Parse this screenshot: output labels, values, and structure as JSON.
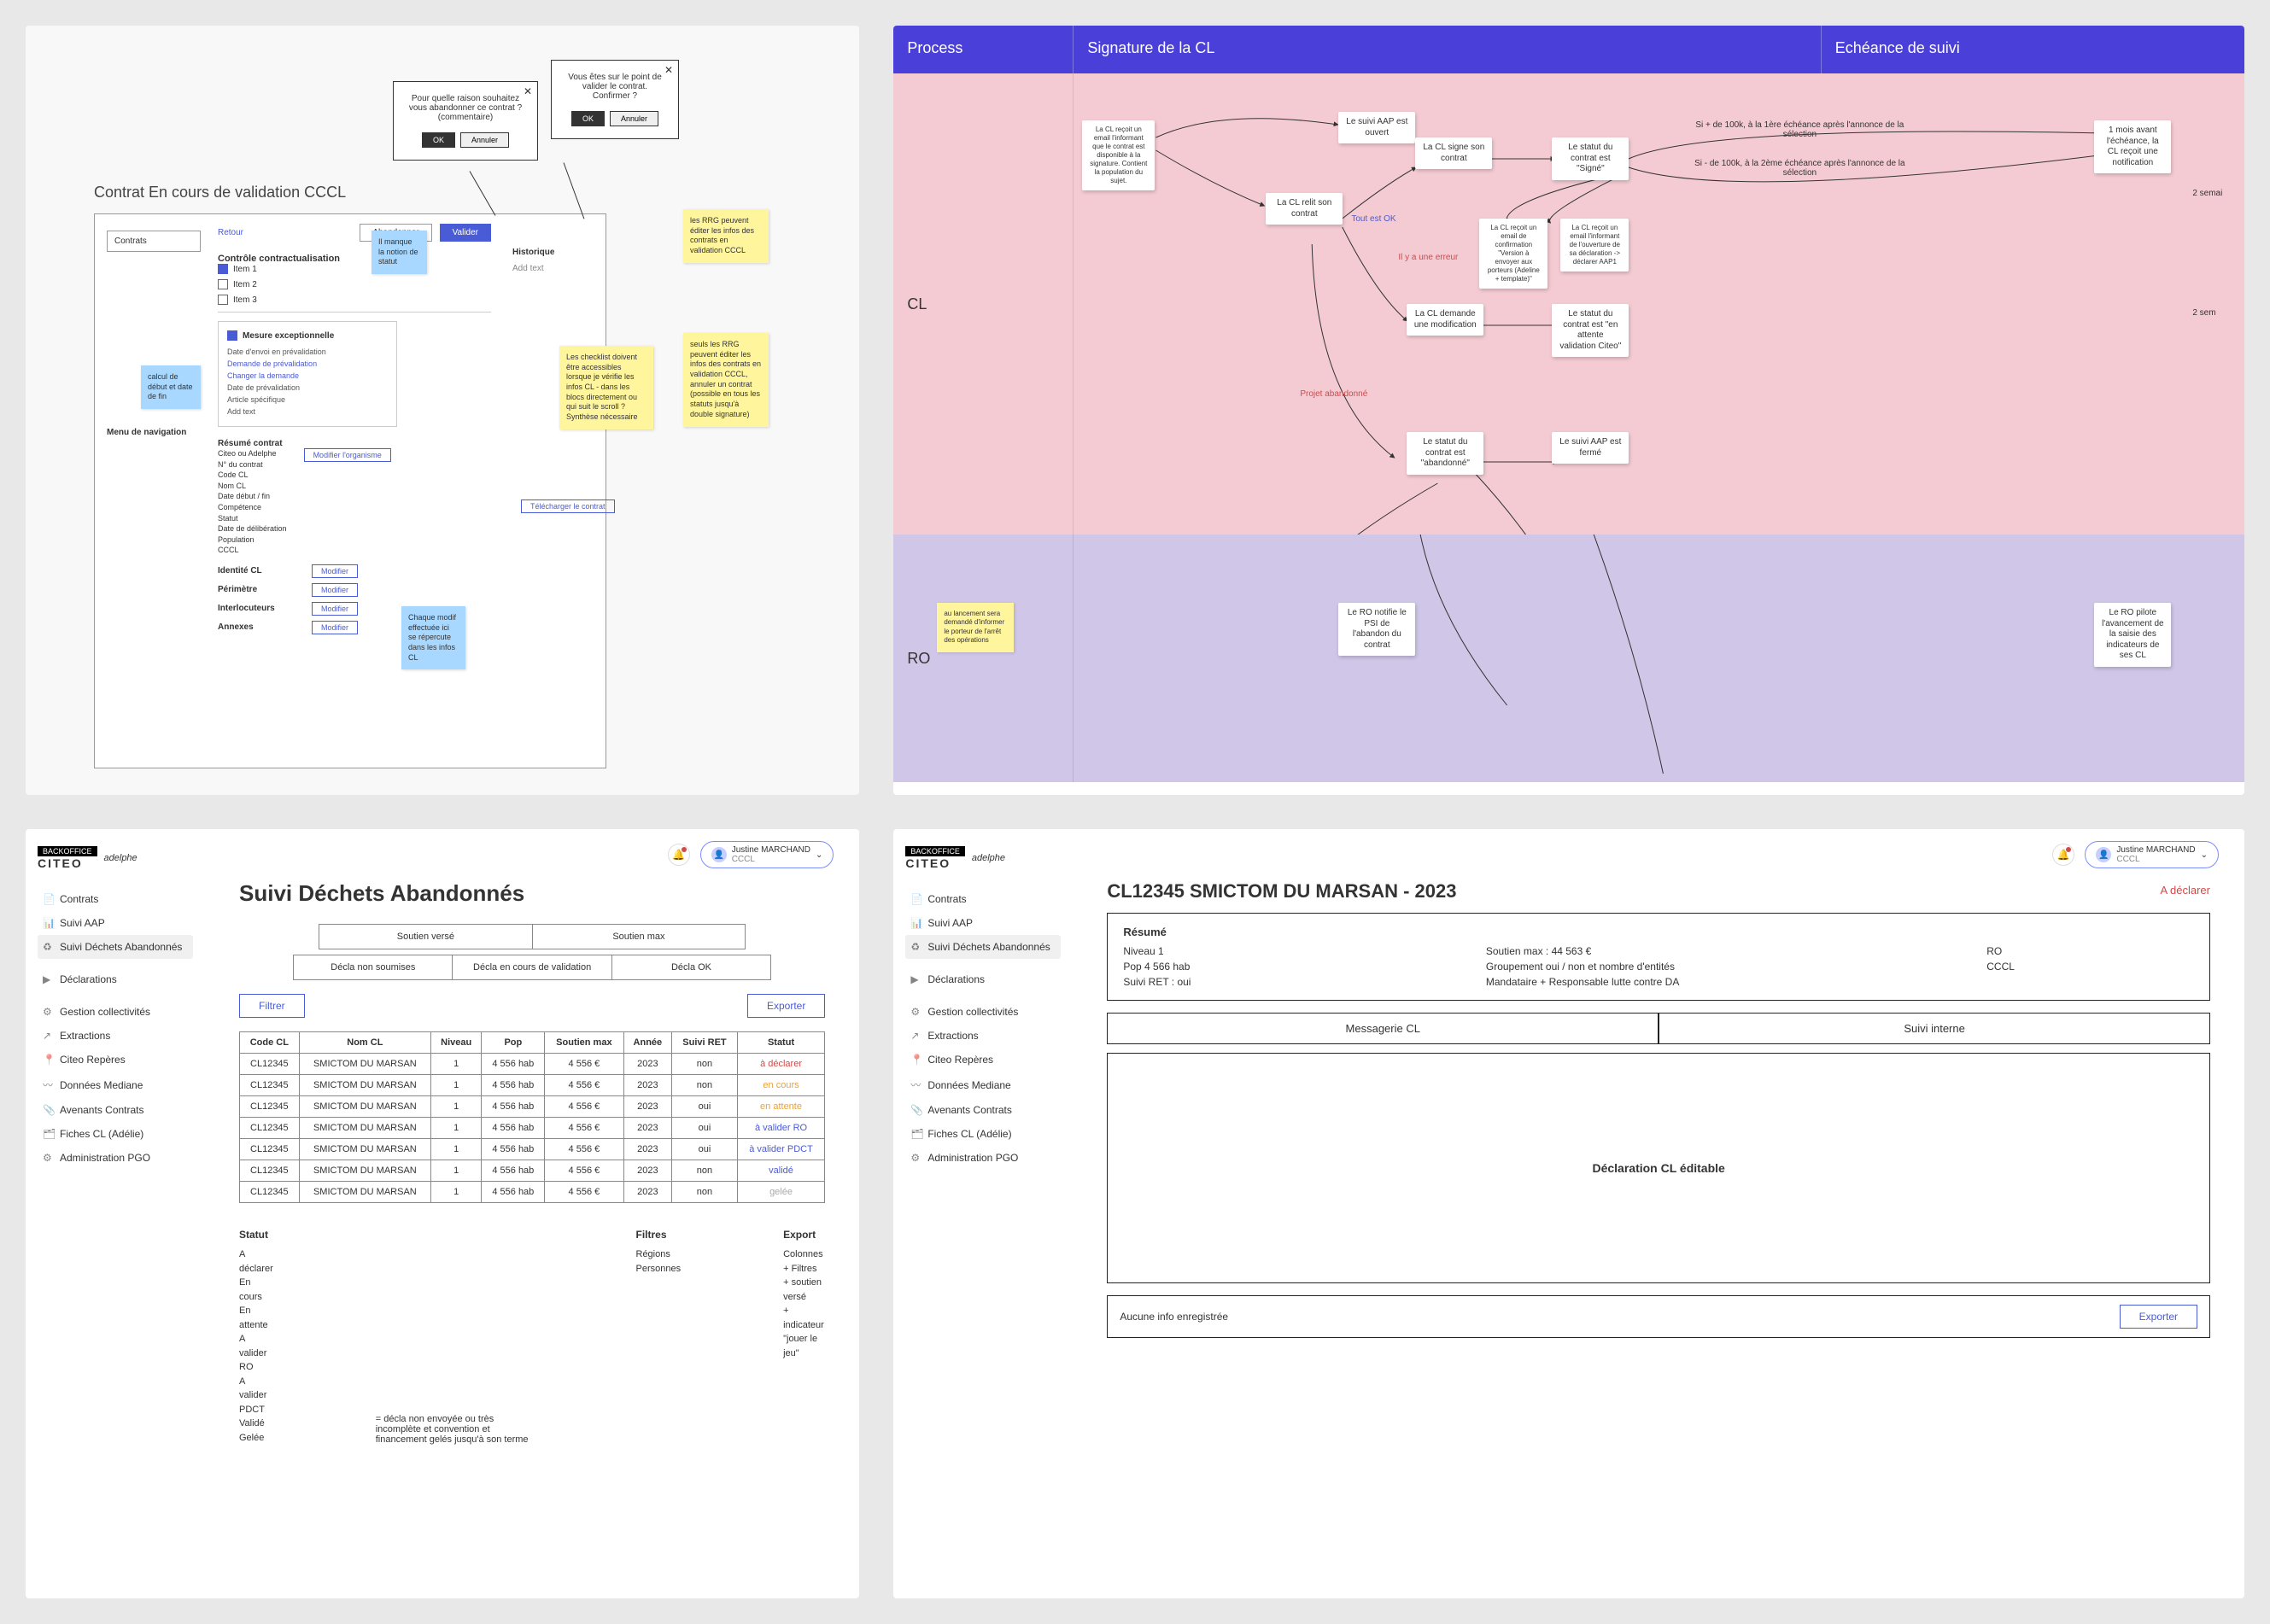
{
  "top_left": {
    "title": "Contrat En cours de validation CCCL",
    "sidebar": {
      "contrats": "Contrats",
      "nav": "Menu de navigation"
    },
    "dialog1": {
      "text": "Pour quelle raison souhaitez vous abandonner ce contrat ? (commentaire)",
      "ok": "OK",
      "cancel": "Annuler"
    },
    "dialog2": {
      "text": "Vous êtes sur le point de valider le contrat. Confirmer ?",
      "ok": "OK",
      "cancel": "Annuler"
    },
    "header": {
      "retour": "Retour",
      "abandon": "Abandonner",
      "valider": "Valider"
    },
    "control_title": "Contrôle contractualisation",
    "items": [
      "Item 1",
      "Item 2",
      "Item 3"
    ],
    "mesure": "Mesure exceptionnelle",
    "mesure_fields": [
      "Date d'envoi en prévalidation",
      "Demande de prévalidation",
      "Changer la demande",
      "Date de prévalidation",
      "Article spécifique",
      "Add text"
    ],
    "hist_title": "Historique",
    "hist_text": "Add text",
    "resume_title": "Résumé contrat",
    "resume_fields": [
      "Citeo ou Adelphe",
      "N° du contrat",
      "Code CL",
      "Nom CL",
      "Date début / fin",
      "Compétence",
      "Statut",
      "Date de délibération",
      "Population",
      "CCCL"
    ],
    "modif_org": "Modifier l'organisme",
    "sections": {
      "identite": "Identité CL",
      "perimetre": "Périmètre",
      "interlocuteurs": "Interlocuteurs",
      "annexes": "Annexes"
    },
    "modifier": "Modifier",
    "download": "Télécharger le contrat",
    "stickies": {
      "blue1": "calcul de début et date de fin",
      "blue2": "Il manque la notion de statut",
      "blue3": "Chaque modif effectuée ici se répercute dans les infos CL",
      "yellow1": "les RRG peuvent éditer les infos des contrats en validation CCCL",
      "yellow2": "Les checklist doivent être accessibles lorsque je vérifie les infos CL - dans les blocs directement ou qui suit le scroll ? Synthèse nécessaire",
      "yellow3": "seuls les RRG peuvent éditer les infos des contrats en validation CCCL, annuler un contrat (possible en tous les statuts jusqu'à double signature)"
    }
  },
  "top_right": {
    "headers": {
      "process": "Process",
      "sig": "Signature de la CL",
      "ech": "Echéance de suivi"
    },
    "lanes": {
      "cl": "CL",
      "ro": "RO"
    },
    "cards": {
      "c1": "La CL reçoit un email l'informant que le contrat est disponible à la signature. Contient la population du sujet.",
      "c2": "Le suivi AAP est ouvert",
      "c3": "La CL relit son contrat",
      "c4": "La CL signe son contrat",
      "c5": "Le statut du contrat est \"Signé\"",
      "c6": "La CL reçoit un email de confirmation \"Version à envoyer aux porteurs (Adeline + template)\"",
      "c7": "La CL reçoit un email l'informant de l'ouverture de sa déclaration -> déclarer AAP1",
      "c8": "La CL demande une modification",
      "c9": "Le statut du contrat est \"en attente validation Citeo\"",
      "c10": "Le statut du contrat est \"abandonné\"",
      "c11": "Le suivi AAP est fermé",
      "c12": "1 mois avant l'échéance, la CL reçoit une notification",
      "c13": "Le RO notifie le PSI de l'abandon du contrat",
      "c14": "Le RO pilote l'avancement de la saisie des indicateurs de ses CL"
    },
    "notes": {
      "ok": "Tout est OK",
      "err": "Il y a une erreur",
      "abandon": "Projet abandonné",
      "n1": "Si + de 100k, à la 1ère échéance après l'annonce de la sélection",
      "n2": "Si - de 100k, à la 2ème échéance après l'annonce de la sélection",
      "sem1": "2 semai",
      "sem2": "2 sem"
    },
    "sticky_ro": "au lancement sera demandé d'informer le porteur de l'arrêt des opérations"
  },
  "app": {
    "brand_badge": "BACKOFFICE",
    "brand_logo": "CITEO",
    "brand_sub": "adelphe",
    "user_name": "Justine MARCHAND",
    "user_role": "CCCL",
    "nav": [
      "Contrats",
      "Suivi AAP",
      "Suivi Déchets Abandonnés",
      "Déclarations",
      "Gestion collectivités",
      "Extractions",
      "Citeo Repères",
      "Données Mediane",
      "Avenants Contrats",
      "Fiches CL (Adélie)",
      "Administration PGO"
    ]
  },
  "list": {
    "title": "Suivi Déchets Abandonnés",
    "tabs1": [
      "Soutien versé",
      "Soutien max"
    ],
    "tabs2": [
      "Décla non soumises",
      "Décla en cours de validation",
      "Décla OK"
    ],
    "filter": "Filtrer",
    "export": "Exporter",
    "cols": [
      "Code CL",
      "Nom CL",
      "Niveau",
      "Pop",
      "Soutien max",
      "Année",
      "Suivi RET",
      "Statut"
    ],
    "rows": [
      {
        "code": "CL12345",
        "nom": "SMICTOM DU MARSAN",
        "niv": "1",
        "pop": "4 556 hab",
        "sout": "4 556 €",
        "an": "2023",
        "ret": "non",
        "st": "à déclarer",
        "cls": "st-red"
      },
      {
        "code": "CL12345",
        "nom": "SMICTOM DU MARSAN",
        "niv": "1",
        "pop": "4 556 hab",
        "sout": "4 556 €",
        "an": "2023",
        "ret": "non",
        "st": "en cours",
        "cls": "st-orange"
      },
      {
        "code": "CL12345",
        "nom": "SMICTOM DU MARSAN",
        "niv": "1",
        "pop": "4 556 hab",
        "sout": "4 556 €",
        "an": "2023",
        "ret": "oui",
        "st": "en attente",
        "cls": "st-orange"
      },
      {
        "code": "CL12345",
        "nom": "SMICTOM DU MARSAN",
        "niv": "1",
        "pop": "4 556 hab",
        "sout": "4 556 €",
        "an": "2023",
        "ret": "oui",
        "st": "à valider RO",
        "cls": "st-blue"
      },
      {
        "code": "CL12345",
        "nom": "SMICTOM DU MARSAN",
        "niv": "1",
        "pop": "4 556 hab",
        "sout": "4 556 €",
        "an": "2023",
        "ret": "oui",
        "st": "à valider PDCT",
        "cls": "st-blue"
      },
      {
        "code": "CL12345",
        "nom": "SMICTOM DU MARSAN",
        "niv": "1",
        "pop": "4 556 hab",
        "sout": "4 556 €",
        "an": "2023",
        "ret": "non",
        "st": "validé",
        "cls": "st-blue"
      },
      {
        "code": "CL12345",
        "nom": "SMICTOM DU MARSAN",
        "niv": "1",
        "pop": "4 556 hab",
        "sout": "4 556 €",
        "an": "2023",
        "ret": "non",
        "st": "gelée",
        "cls": "st-grey"
      }
    ],
    "legend": {
      "statut_h": "Statut",
      "statut": [
        "A déclarer",
        "En cours",
        "En attente",
        "A valider RO",
        "A valider PDCT",
        "Validé",
        "Gelée"
      ],
      "gelee_note": "= décla non envoyée ou très incomplète et convention et financement gelés jusqu'à son terme",
      "filtres_h": "Filtres",
      "filtres": [
        "Régions",
        "Personnes"
      ],
      "export_h": "Export",
      "export": [
        "Colonnes + Filtres",
        "+ soutien versé",
        "+ indicateur \"jouer le jeu\""
      ]
    }
  },
  "detail": {
    "title": "CL12345 SMICTOM DU MARSAN - 2023",
    "badge": "A déclarer",
    "resume_h": "Résumé",
    "resume": {
      "a1": "Niveau 1",
      "a2": "Pop 4 566 hab",
      "a3": "Suivi RET : oui",
      "b1": "Soutien max : 44 563 €",
      "b2": "Groupement oui / non et nombre d'entités",
      "b3": "Mandataire + Responsable lutte contre DA",
      "c1": "RO",
      "c2": "CCCL"
    },
    "tab1": "Messagerie CL",
    "tab2": "Suivi interne",
    "panel": "Déclaration CL éditable",
    "footer": "Aucune info enregistrée",
    "export": "Exporter"
  }
}
